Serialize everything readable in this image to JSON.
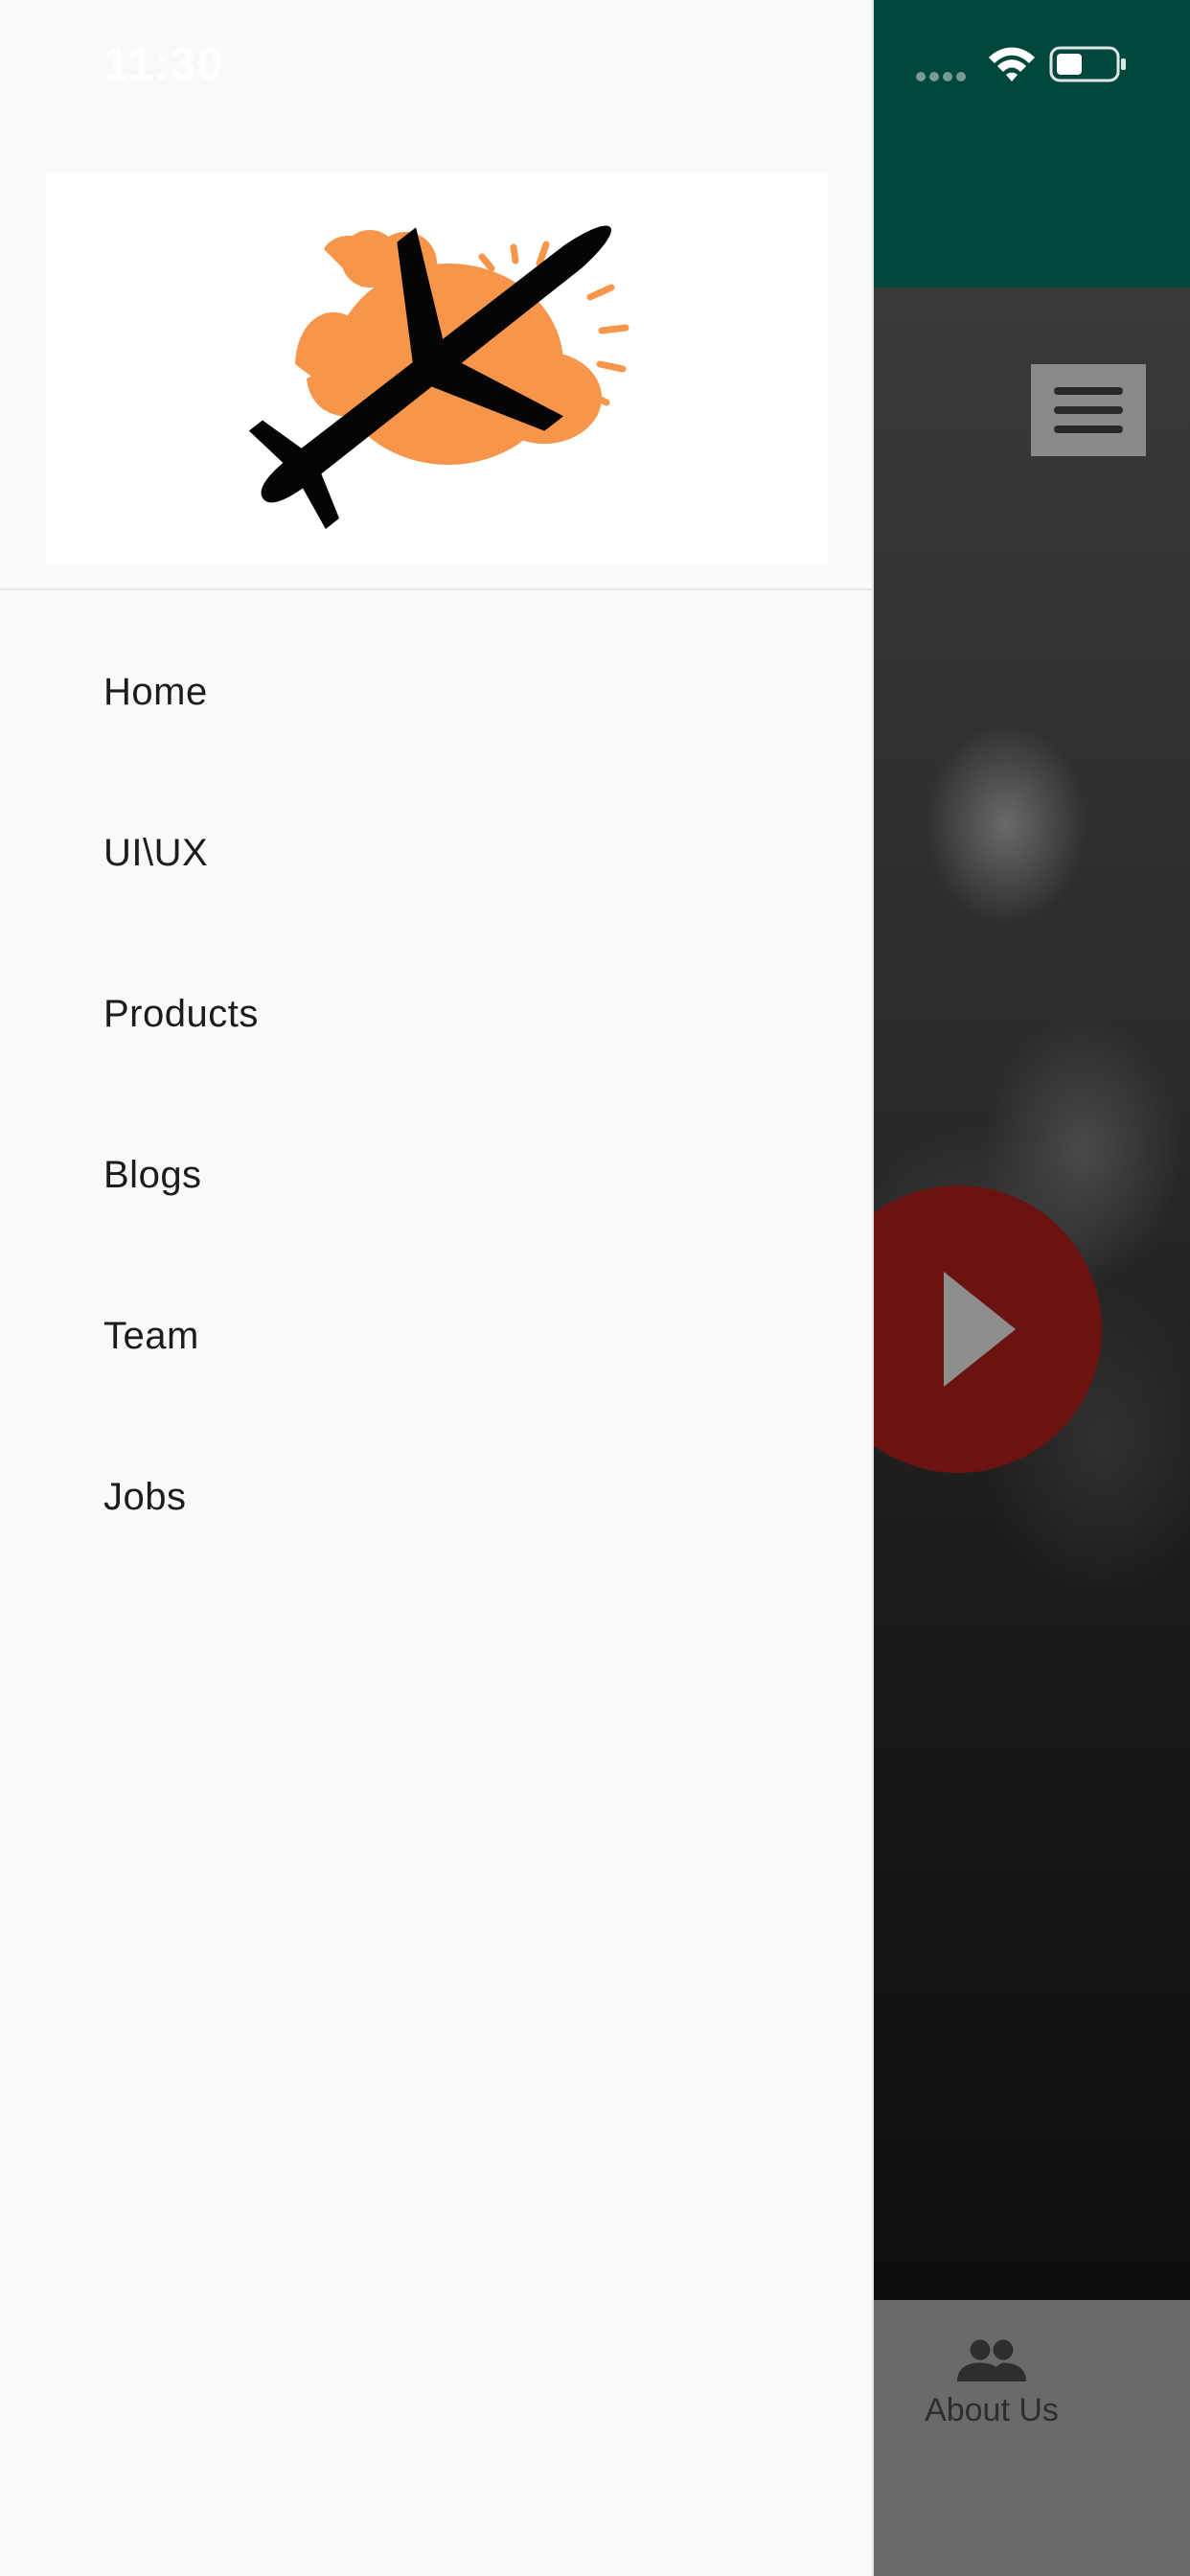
{
  "status_bar": {
    "time": "11:30"
  },
  "drawer": {
    "items": [
      {
        "label": "Home"
      },
      {
        "label": "UI\\UX"
      },
      {
        "label": "Products"
      },
      {
        "label": "Blogs"
      },
      {
        "label": "Team"
      },
      {
        "label": "Jobs"
      }
    ]
  },
  "bottom_nav": {
    "about_label": "About Us"
  },
  "colors": {
    "app_bar": "#00473c",
    "logo_orange": "#f7954a",
    "play_button": "#6b1310",
    "drawer_bg": "#f9f9f9"
  },
  "icons": [
    "menu-icon",
    "play-icon",
    "people-icon",
    "wifi-icon",
    "battery-icon",
    "signal-icon",
    "airplane-logo-icon"
  ]
}
